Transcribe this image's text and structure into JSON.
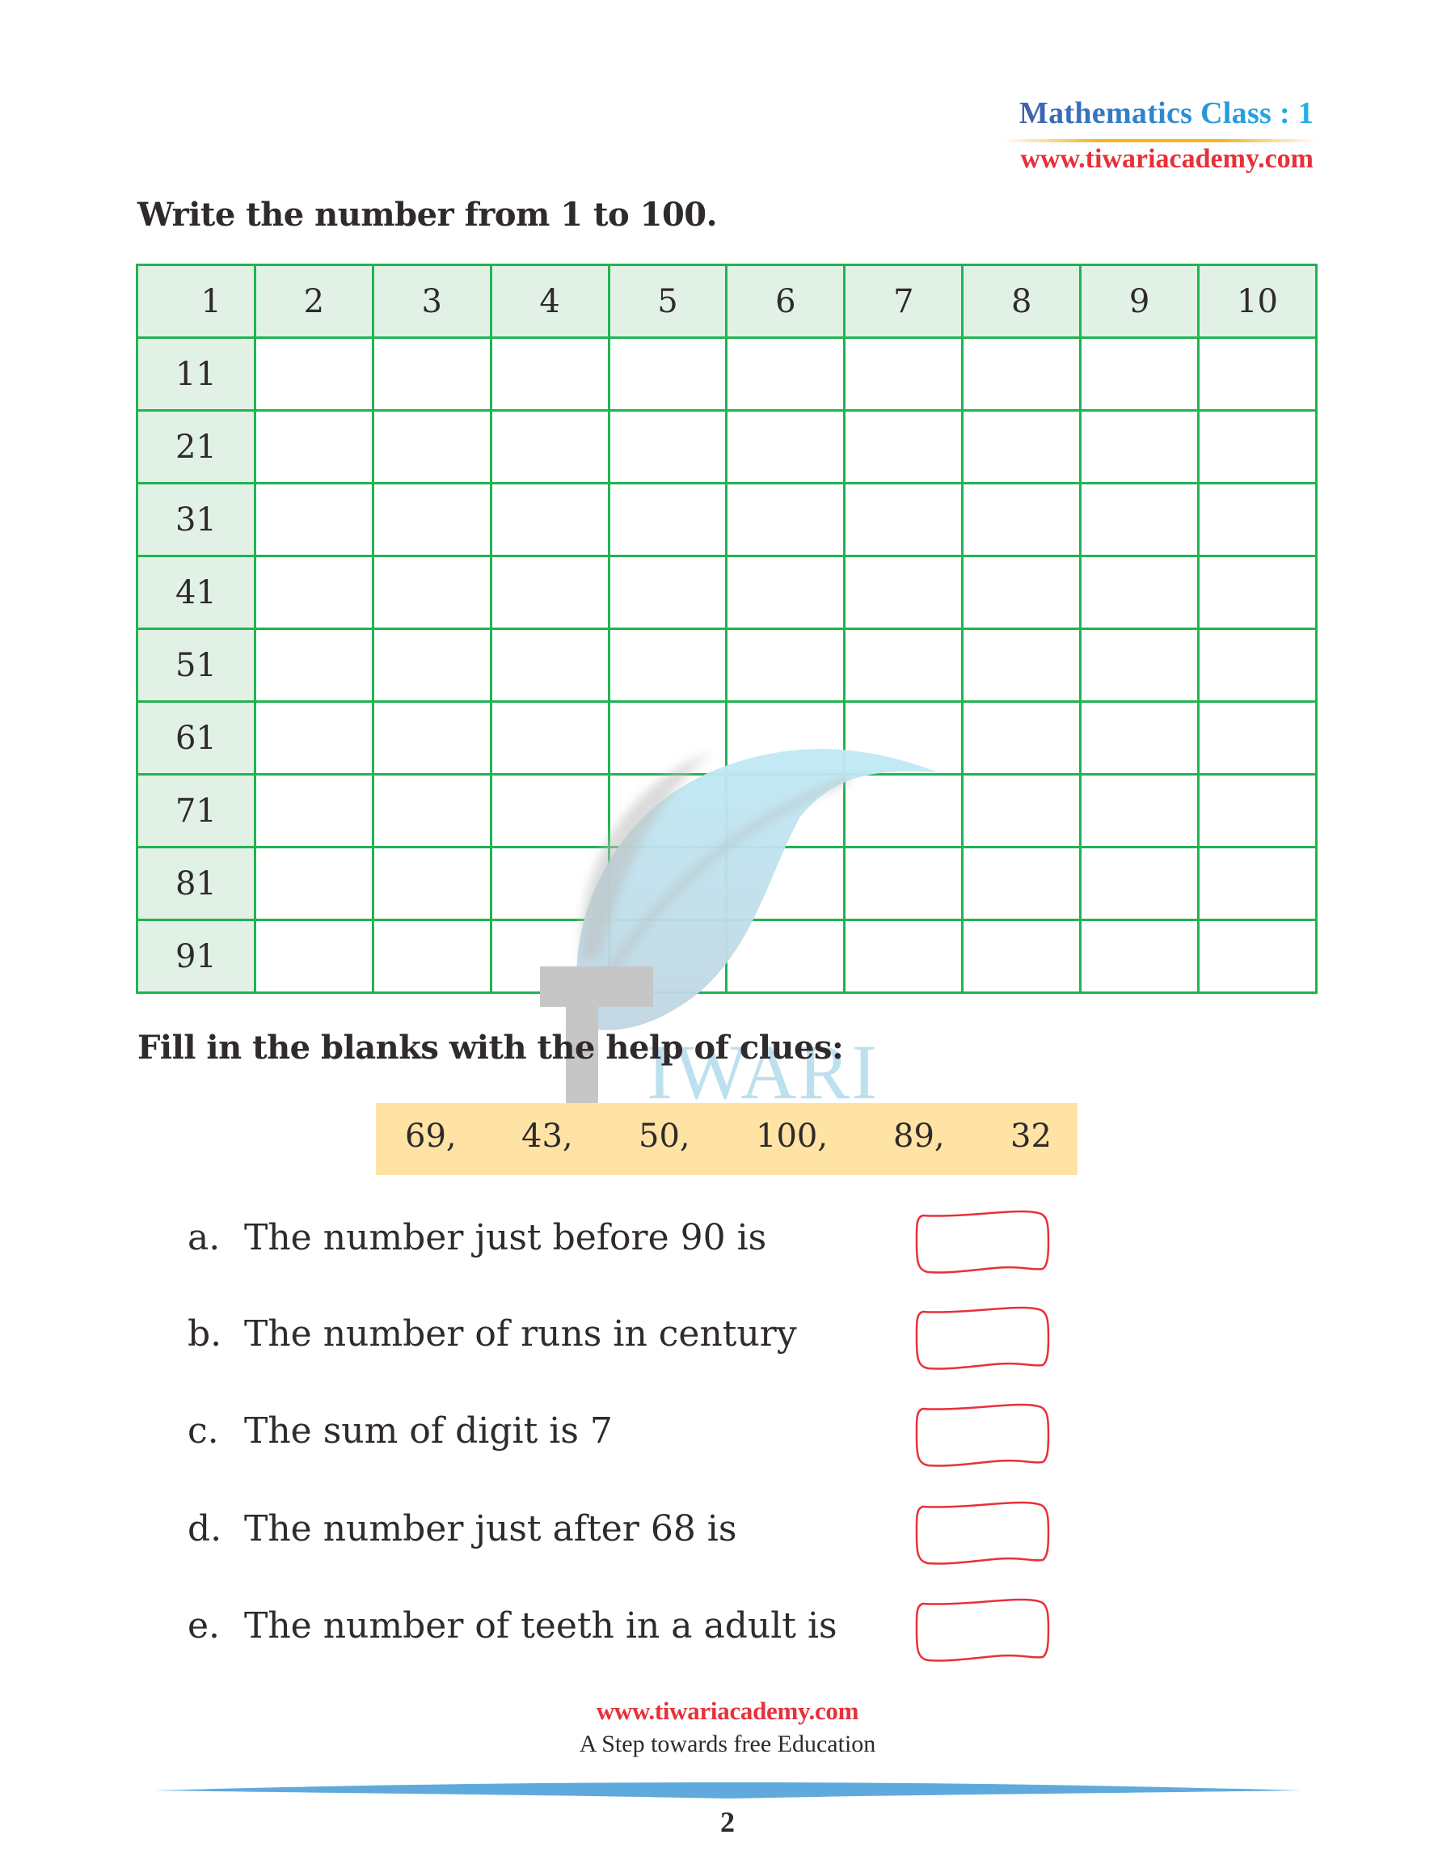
{
  "header": {
    "title": "Mathematics Class : 1",
    "url": "www.tiwariacademy.com"
  },
  "section1": {
    "heading": "Write the number from 1 to 100.",
    "grid": {
      "rows": 10,
      "cols": 10,
      "top_row": [
        "1",
        "2",
        "3",
        "4",
        "5",
        "6",
        "7",
        "8",
        "9",
        "10"
      ],
      "first_column": [
        "1",
        "11",
        "21",
        "31",
        "41",
        "51",
        "61",
        "71",
        "81",
        "91"
      ],
      "border_color": "#21b352",
      "fill_color": "#e1f1e6"
    }
  },
  "watermark": {
    "letter": "T",
    "text": "IWARI"
  },
  "section2": {
    "heading": "Fill in the blanks with the help of clues:",
    "clues": [
      "69,",
      "43,",
      "50,",
      "100,",
      "89,",
      "32"
    ],
    "clue_bg": "#fee3a5",
    "questions": [
      {
        "letter": "a.",
        "text": "The number just before 90 is",
        "answer": ""
      },
      {
        "letter": "b.",
        "text": "The number of runs in century",
        "answer": ""
      },
      {
        "letter": "c.",
        "text": "The sum of digit is 7",
        "answer": ""
      },
      {
        "letter": "d.",
        "text": "The number just after 68 is",
        "answer": ""
      },
      {
        "letter": "e.",
        "text": "The number of teeth in a adult is",
        "answer": ""
      }
    ],
    "answer_box_color": "#e8303a"
  },
  "footer": {
    "url": "www.tiwariacademy.com",
    "tagline": "A Step towards free Education",
    "page_number": "2",
    "bar_color": "#5faadc"
  }
}
